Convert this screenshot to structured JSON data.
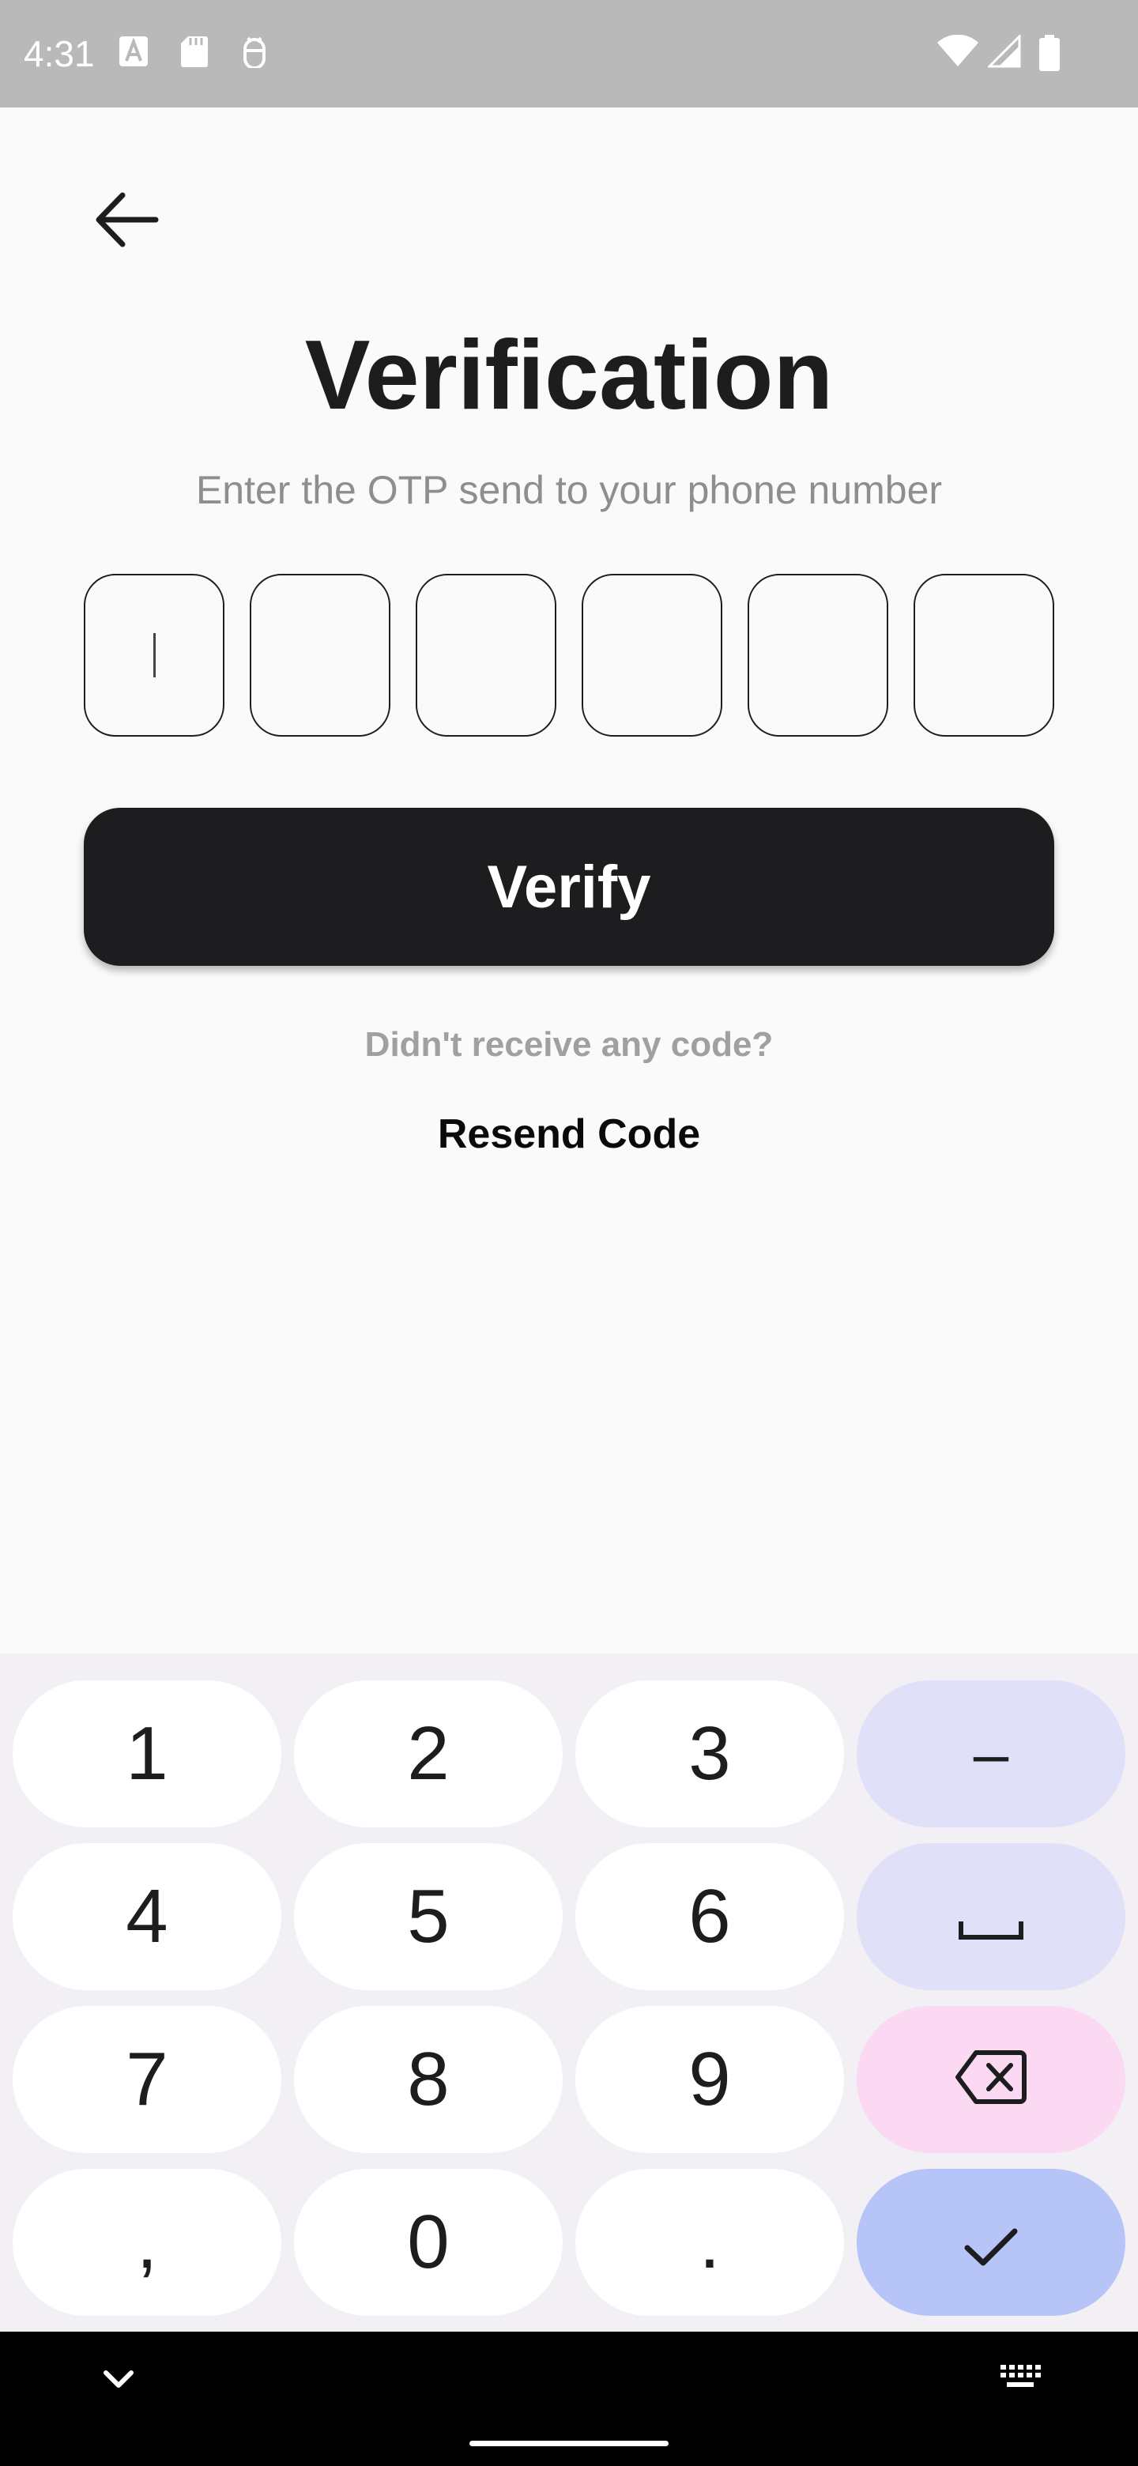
{
  "status_bar": {
    "time": "4:31",
    "icons_left": [
      "a-notification-icon",
      "sd-card-icon",
      "android-debug-icon"
    ],
    "icons_right": [
      "wifi-icon",
      "signal-icon",
      "battery-icon"
    ]
  },
  "header": {
    "back_icon": "arrow-left-icon"
  },
  "page": {
    "title": "Verification",
    "subtitle": "Enter the OTP send to your phone number"
  },
  "otp": {
    "digits": [
      "",
      "",
      "",
      "",
      "",
      ""
    ],
    "focused_index": 0
  },
  "verify_button": {
    "label": "Verify"
  },
  "resend": {
    "prompt": "Didn't receive any code?",
    "link": "Resend Code"
  },
  "keyboard": {
    "rows": [
      [
        "1",
        "2",
        "3",
        "–"
      ],
      [
        "4",
        "5",
        "6",
        "space"
      ],
      [
        "7",
        "8",
        "9",
        "backspace"
      ],
      [
        ",",
        "0",
        ".",
        "enter"
      ]
    ],
    "labels": {
      "k1": "1",
      "k2": "2",
      "k3": "3",
      "dash": "–",
      "k4": "4",
      "k5": "5",
      "k6": "6",
      "k7": "7",
      "k8": "8",
      "k9": "9",
      "comma": ",",
      "k0": "0",
      "period": "."
    },
    "colors": {
      "key": "#FFFFFF",
      "function_key": "#E0E0F8",
      "backspace_key": "#FBD9F2",
      "enter_key": "#B7C4F8",
      "background": "#F2EFF5"
    }
  },
  "nav_bar": {
    "left_icon": "chevron-down-icon",
    "right_icon": "keyboard-icon"
  },
  "colors": {
    "primary": "#1D1D20",
    "subtitle_text": "#8E8E90",
    "background": "#FAFAFA"
  }
}
